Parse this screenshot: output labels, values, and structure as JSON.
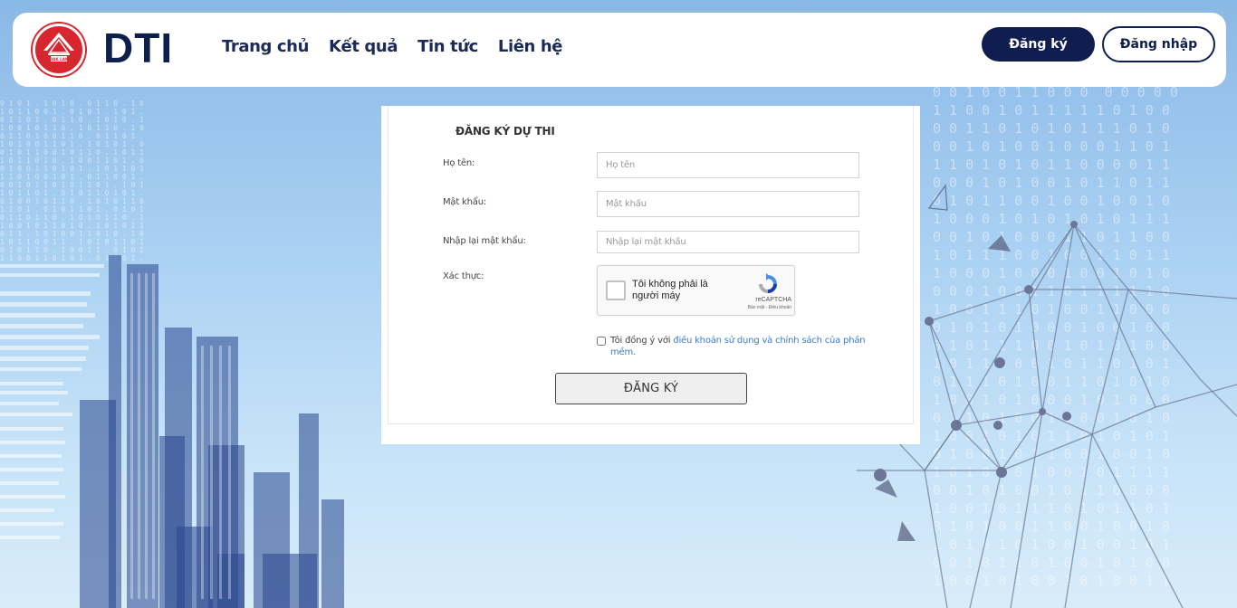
{
  "header": {
    "logo_badge_text": "DAK LAK",
    "brand": "DTI",
    "nav": [
      "Trang chủ",
      "Kết quả",
      "Tin tức",
      "Liên hệ"
    ],
    "register_label": "Đăng ký",
    "login_label": "Đăng nhập"
  },
  "form": {
    "title": "ĐĂNG KÝ DỰ THI",
    "fullname_label": "Họ tên:",
    "fullname_placeholder": "Họ tên",
    "password_label": "Mật khẩu:",
    "password_placeholder": "Mật khẩu",
    "confirm_label": "Nhập lại mật khẩu:",
    "confirm_placeholder": "Nhập lại mật khẩu",
    "captcha_label": "Xác thực:",
    "captcha": {
      "text": "Tôi không phải là người máy",
      "brand": "reCAPTCHA",
      "links": "Bảo mật - Điều khoản"
    },
    "agree_prefix": "Tôi đồng ý với ",
    "agree_link": "điều khoản sử dụng và chính sách của phần mềm.",
    "submit_label": "ĐĂNG KÝ"
  },
  "colors": {
    "navy": "#0f1e4e",
    "brand_red": "#d7262e",
    "link_blue": "#3b7bc8"
  }
}
